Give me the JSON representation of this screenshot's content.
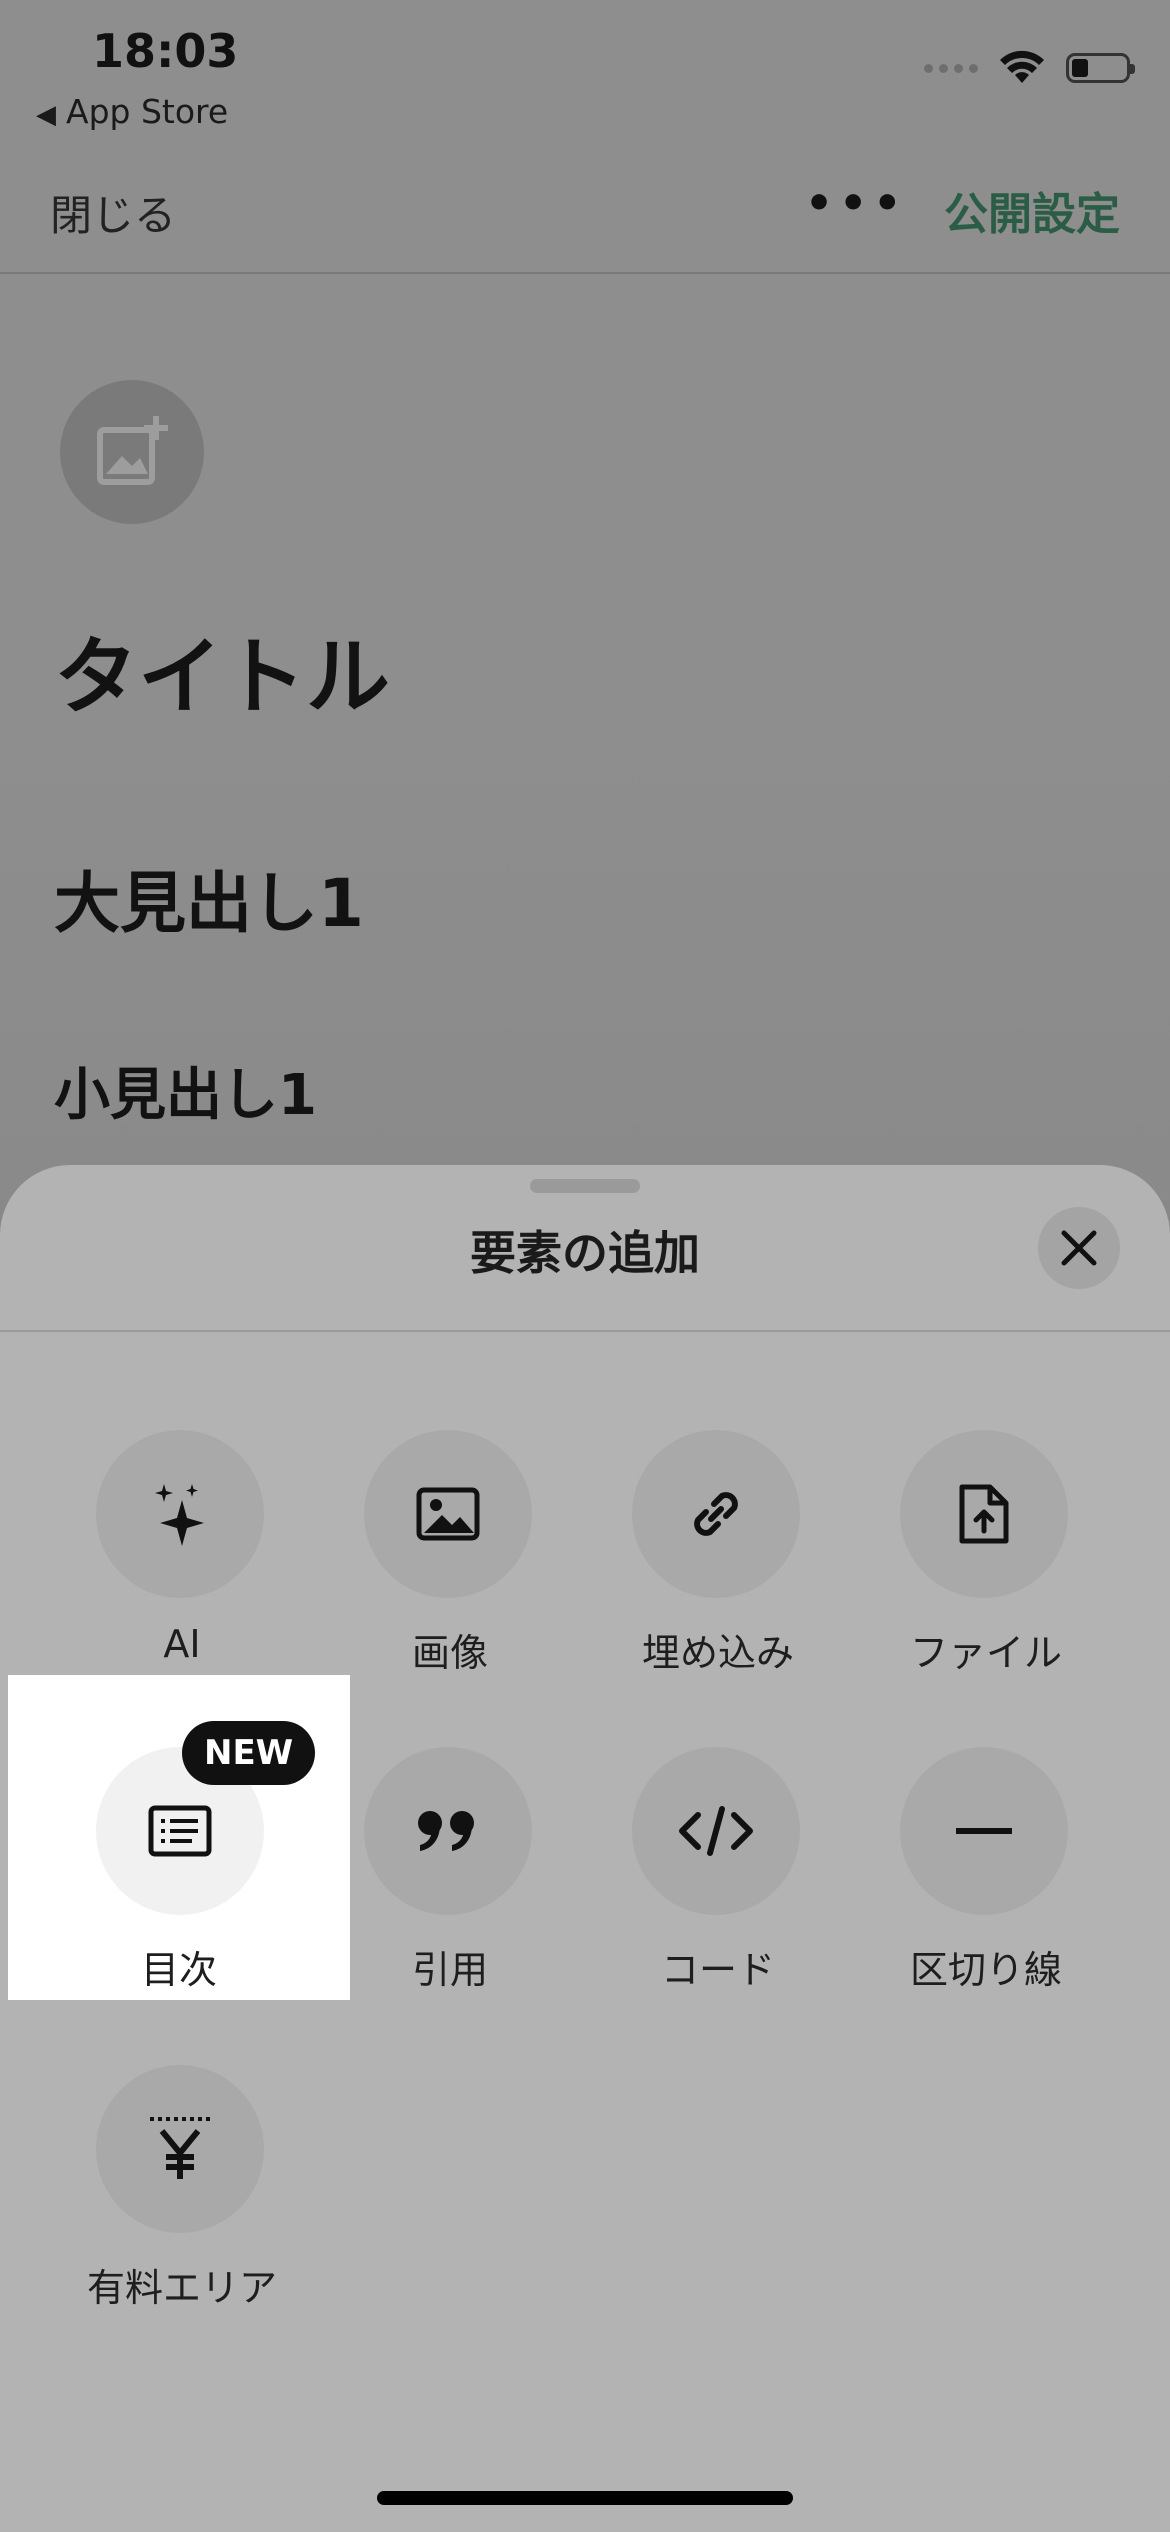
{
  "status": {
    "time": "18:03",
    "back_app": "App Store"
  },
  "topbar": {
    "close_label": "閉じる",
    "more_label": "•••",
    "publish_label": "公開設定"
  },
  "editor": {
    "title_placeholder": "タイトル",
    "heading_large": "大見出し1",
    "heading_small": "小見出し1"
  },
  "sheet": {
    "title": "要素の追加",
    "badge_new": "NEW",
    "items": [
      {
        "label": "AI",
        "icon": "sparkles-icon"
      },
      {
        "label": "画像",
        "icon": "image-icon"
      },
      {
        "label": "埋め込み",
        "icon": "link-icon"
      },
      {
        "label": "ファイル",
        "icon": "file-upload-icon"
      },
      {
        "label": "目次",
        "icon": "table-of-contents-icon"
      },
      {
        "label": "引用",
        "icon": "quote-icon"
      },
      {
        "label": "コード",
        "icon": "code-icon"
      },
      {
        "label": "区切り線",
        "icon": "divider-line-icon"
      },
      {
        "label": "有料エリア",
        "icon": "yen-paid-area-icon"
      }
    ]
  }
}
